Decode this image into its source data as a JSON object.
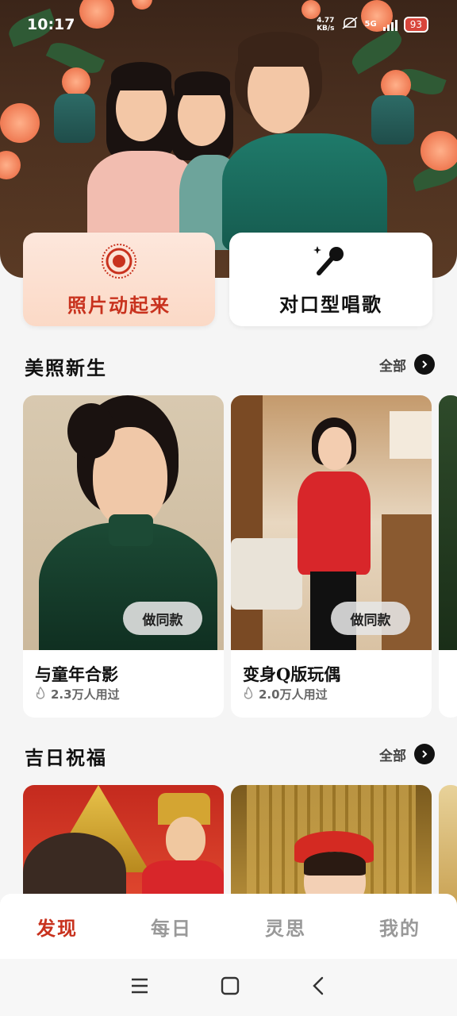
{
  "status_bar": {
    "time": "10:17",
    "net_speed": "4.77",
    "net_unit": "KB/s",
    "network": "5G",
    "battery": "93"
  },
  "features": [
    {
      "label": "照片动起来",
      "icon": "target-rings-icon"
    },
    {
      "label": "对口型唱歌",
      "icon": "microphone-sparkle-icon"
    }
  ],
  "sections": [
    {
      "title": "美照新生",
      "see_all": "全部",
      "cards": [
        {
          "title": "与童年合影",
          "uses": "2.3万人用过",
          "button": "做同款"
        },
        {
          "title": "变身Q版玩偶",
          "uses": "2.0万人用过",
          "button": "做同款"
        }
      ]
    },
    {
      "title": "吉日祝福",
      "see_all": "全部"
    }
  ],
  "bottom_nav": [
    {
      "label": "发现",
      "active": true
    },
    {
      "label": "每日",
      "active": false
    },
    {
      "label": "灵思",
      "active": false
    },
    {
      "label": "我的",
      "active": false
    }
  ],
  "colors": {
    "accent": "#c8321e",
    "feature_bg": "#fde7dc"
  }
}
